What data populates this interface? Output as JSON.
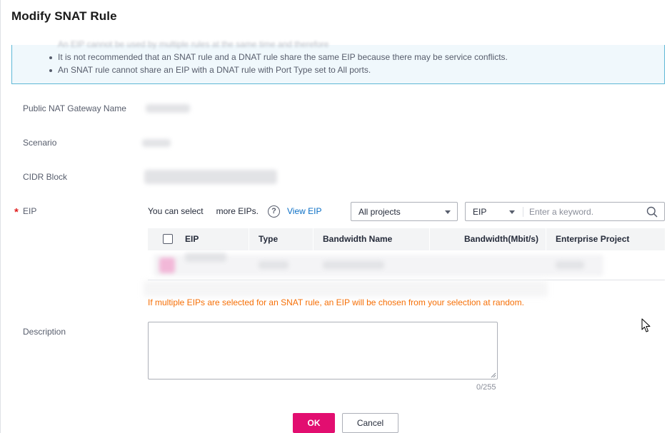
{
  "dialog": {
    "title": "Modify SNAT Rule"
  },
  "notice": {
    "items": [
      "It is not recommended that an SNAT rule and a DNAT rule share the same EIP because there may be service conflicts.",
      "An SNAT rule cannot share an EIP with a DNAT rule with Port Type set to All ports."
    ]
  },
  "form": {
    "gateway_label": "Public NAT Gateway Name",
    "scenario_label": "Scenario",
    "cidr_label": "CIDR Block",
    "eip_label": "EIP",
    "required_mark": "*",
    "eip_tip_prefix": "You can select",
    "eip_tip_suffix": "more EIPs.",
    "help_glyph": "?",
    "view_eip_link": "View EIP",
    "project_select": "All projects",
    "search_type_select": "EIP",
    "search_placeholder": "Enter a keyword.",
    "description_label": "Description",
    "description_counter": "0/255",
    "random_warning": "If multiple EIPs are selected for an SNAT rule, an EIP will be chosen from your selection at random."
  },
  "table": {
    "columns": [
      "EIP",
      "Type",
      "Bandwidth Name",
      "Bandwidth(Mbit/s)",
      "Enterprise Project"
    ]
  },
  "buttons": {
    "ok": "OK",
    "cancel": "Cancel"
  },
  "icons": {
    "help": "help-circle-icon",
    "search": "search-icon",
    "caret": "chevron-down-icon",
    "cursor": "mouse-pointer-icon"
  },
  "colors": {
    "primary": "#e20e70",
    "link": "#0b6fc5",
    "warning": "#f66f06",
    "notice_bg": "#f0f8fc",
    "notice_border": "#5eb8d6",
    "required": "#e02020"
  }
}
